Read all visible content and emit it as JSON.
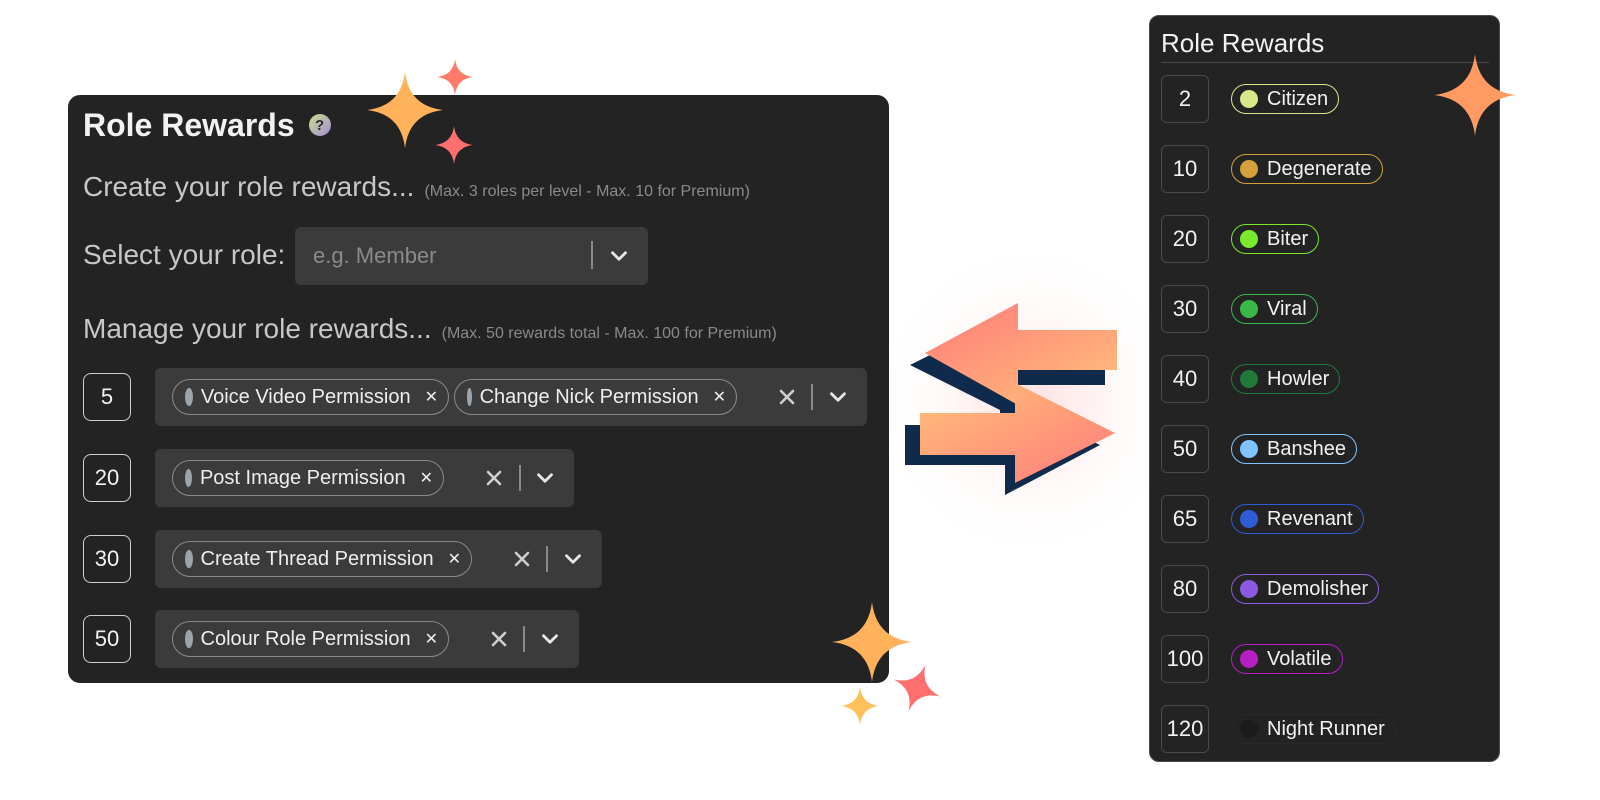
{
  "left_panel": {
    "title": "Role Rewards",
    "help_icon": "question-mark-icon",
    "create_heading": "Create your role rewards...",
    "create_note": "(Max. 3 roles per level - Max. 10 for Premium)",
    "select_label": "Select your role:",
    "select_placeholder": "e.g. Member",
    "manage_heading": "Manage your role rewards...",
    "manage_note": "(Max. 50 rewards total - Max. 100 for Premium)",
    "rewards": [
      {
        "level": "5",
        "roles": [
          "Voice Video Permission",
          "Change Nick Permission"
        ]
      },
      {
        "level": "20",
        "roles": [
          "Post Image Permission"
        ]
      },
      {
        "level": "30",
        "roles": [
          "Create Thread Permission"
        ]
      },
      {
        "level": "50",
        "roles": [
          "Colour Role Permission"
        ]
      }
    ]
  },
  "right_panel": {
    "title": "Role Rewards",
    "items": [
      {
        "level": "2",
        "role": "Citizen",
        "color": "#d9e88a"
      },
      {
        "level": "10",
        "role": "Degenerate",
        "color": "#d4a13c"
      },
      {
        "level": "20",
        "role": "Biter",
        "color": "#7bea2a"
      },
      {
        "level": "30",
        "role": "Viral",
        "color": "#3bb84a"
      },
      {
        "level": "40",
        "role": "Howler",
        "color": "#1f7a3a"
      },
      {
        "level": "50",
        "role": "Banshee",
        "color": "#7fc4ff"
      },
      {
        "level": "65",
        "role": "Revenant",
        "color": "#2f5bd6"
      },
      {
        "level": "80",
        "role": "Demolisher",
        "color": "#8c5ae0"
      },
      {
        "level": "100",
        "role": "Volatile",
        "color": "#b51fc4"
      },
      {
        "level": "120",
        "role": "Night Runner",
        "color": "#1b1b1b"
      }
    ]
  },
  "accent": {
    "orange": "#ffb25a",
    "coral": "#ff6f6f",
    "navy": "#0f2a4a"
  }
}
